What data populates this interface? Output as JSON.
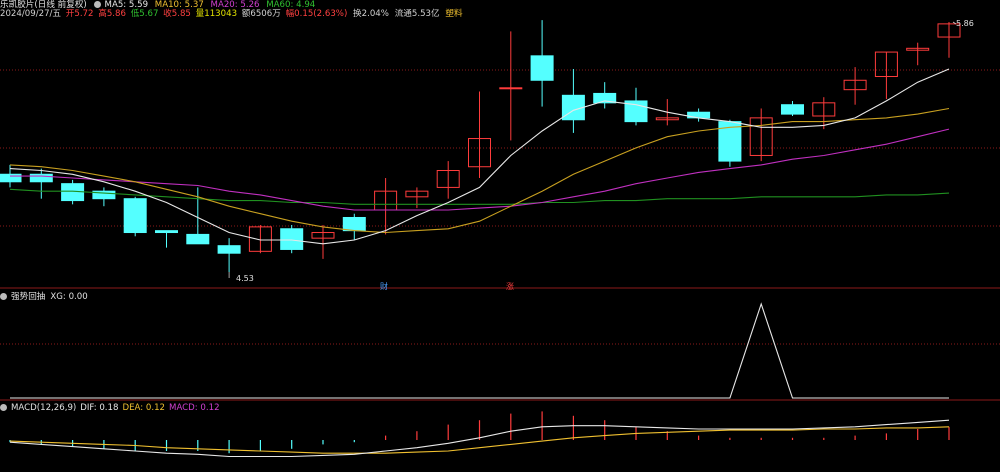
{
  "header": {
    "title": "乐凯胶片(日线 前复权)",
    "ma5": {
      "label": "MA5: 5.59",
      "color": "#e8e8e8"
    },
    "ma10": {
      "label": "MA10: 5.37",
      "color": "#f0c030"
    },
    "ma20": {
      "label": "MA20: 5.26",
      "color": "#d040d0"
    },
    "ma60": {
      "label": "MA60: 4.94",
      "color": "#30c030"
    },
    "date": "2024/09/27/五",
    "open": "开5.72",
    "high": "高5.86",
    "low": "低5.67",
    "close": "收5.85",
    "volume": "量113043",
    "amount": "额6506万",
    "change": "幅0.15(2.63%)",
    "turnover": "换2.04%",
    "float_cap": "流通5.53亿",
    "sector": "塑料"
  },
  "annotations": {
    "high_label": "5.86",
    "low_label": "4.53",
    "tag_cai": "财",
    "tag_zhang": "涨"
  },
  "indicator1": {
    "title": "强势回抽",
    "value": "XG: 0.00"
  },
  "indicator2": {
    "title": "MACD(12,26,9)",
    "dif": "DIF: 0.18",
    "dea": "DEA: 0.12",
    "macd": "MACD: 0.12"
  },
  "colors": {
    "up": "#ff3c3c",
    "down": "#54ffff",
    "grid": "#8b1a1a",
    "ma5": "#e8e8e8",
    "ma10": "#c8a020",
    "ma20": "#c030c0",
    "ma60": "#209020"
  },
  "chart_data": {
    "type": "candlestick",
    "candles": [
      {
        "o": 5.05,
        "h": 5.1,
        "l": 4.98,
        "c": 5.01
      },
      {
        "o": 5.05,
        "h": 5.08,
        "l": 4.92,
        "c": 5.01
      },
      {
        "o": 5.0,
        "h": 5.02,
        "l": 4.89,
        "c": 4.91
      },
      {
        "o": 4.96,
        "h": 4.98,
        "l": 4.88,
        "c": 4.92
      },
      {
        "o": 4.92,
        "h": 4.93,
        "l": 4.72,
        "c": 4.74
      },
      {
        "o": 4.75,
        "h": 4.75,
        "l": 4.66,
        "c": 4.74
      },
      {
        "o": 4.73,
        "h": 4.98,
        "l": 4.69,
        "c": 4.68
      },
      {
        "o": 4.67,
        "h": 4.71,
        "l": 4.53,
        "c": 4.63
      },
      {
        "o": 4.64,
        "h": 4.78,
        "l": 4.63,
        "c": 4.77
      },
      {
        "o": 4.76,
        "h": 4.78,
        "l": 4.63,
        "c": 4.65
      },
      {
        "o": 4.71,
        "h": 4.78,
        "l": 4.6,
        "c": 4.74
      },
      {
        "o": 4.82,
        "h": 4.84,
        "l": 4.7,
        "c": 4.75
      },
      {
        "o": 4.86,
        "h": 5.03,
        "l": 4.73,
        "c": 4.96
      },
      {
        "o": 4.93,
        "h": 4.98,
        "l": 4.87,
        "c": 4.96
      },
      {
        "o": 4.98,
        "h": 5.12,
        "l": 4.92,
        "c": 5.07
      },
      {
        "o": 5.09,
        "h": 5.49,
        "l": 5.03,
        "c": 5.24
      },
      {
        "o": 5.51,
        "h": 5.81,
        "l": 5.23,
        "c": 5.51
      },
      {
        "o": 5.68,
        "h": 5.87,
        "l": 5.41,
        "c": 5.55
      },
      {
        "o": 5.47,
        "h": 5.61,
        "l": 5.27,
        "c": 5.34
      },
      {
        "o": 5.48,
        "h": 5.54,
        "l": 5.4,
        "c": 5.43
      },
      {
        "o": 5.44,
        "h": 5.51,
        "l": 5.31,
        "c": 5.33
      },
      {
        "o": 5.34,
        "h": 5.45,
        "l": 5.31,
        "c": 5.35
      },
      {
        "o": 5.38,
        "h": 5.4,
        "l": 5.33,
        "c": 5.35
      },
      {
        "o": 5.33,
        "h": 5.34,
        "l": 5.09,
        "c": 5.12
      },
      {
        "o": 5.15,
        "h": 5.4,
        "l": 5.12,
        "c": 5.35
      },
      {
        "o": 5.42,
        "h": 5.44,
        "l": 5.36,
        "c": 5.37
      },
      {
        "o": 5.36,
        "h": 5.46,
        "l": 5.29,
        "c": 5.43
      },
      {
        "o": 5.5,
        "h": 5.62,
        "l": 5.42,
        "c": 5.55
      },
      {
        "o": 5.57,
        "h": 5.7,
        "l": 5.45,
        "c": 5.7
      },
      {
        "o": 5.71,
        "h": 5.75,
        "l": 5.63,
        "c": 5.72
      },
      {
        "o": 5.78,
        "h": 5.86,
        "l": 5.67,
        "c": 5.85
      }
    ],
    "ma5": [
      5.08,
      5.07,
      5.05,
      5.01,
      4.96,
      4.9,
      4.82,
      4.74,
      4.7,
      4.7,
      4.68,
      4.7,
      4.75,
      4.83,
      4.9,
      4.98,
      5.15,
      5.28,
      5.39,
      5.44,
      5.42,
      5.38,
      5.35,
      5.33,
      5.3,
      5.3,
      5.31,
      5.35,
      5.44,
      5.54,
      5.61
    ],
    "ma10": [
      5.1,
      5.09,
      5.07,
      5.04,
      5.01,
      4.97,
      4.93,
      4.88,
      4.84,
      4.8,
      4.77,
      4.75,
      4.74,
      4.75,
      4.76,
      4.8,
      4.88,
      4.96,
      5.05,
      5.12,
      5.19,
      5.25,
      5.28,
      5.3,
      5.31,
      5.33,
      5.33,
      5.34,
      5.35,
      5.37,
      5.4
    ],
    "ma20": [
      5.04,
      5.04,
      5.03,
      5.02,
      5.01,
      5.0,
      4.99,
      4.96,
      4.94,
      4.91,
      4.88,
      4.86,
      4.86,
      4.86,
      4.86,
      4.87,
      4.88,
      4.9,
      4.93,
      4.96,
      5.0,
      5.03,
      5.06,
      5.08,
      5.1,
      5.13,
      5.15,
      5.18,
      5.21,
      5.25,
      5.29
    ],
    "ma60": [
      4.97,
      4.96,
      4.96,
      4.95,
      4.94,
      4.93,
      4.92,
      4.91,
      4.91,
      4.9,
      4.9,
      4.89,
      4.89,
      4.89,
      4.89,
      4.89,
      4.89,
      4.9,
      4.9,
      4.91,
      4.91,
      4.92,
      4.92,
      4.92,
      4.93,
      4.93,
      4.93,
      4.93,
      4.94,
      4.94,
      4.95
    ],
    "xg": [
      0,
      0,
      0,
      0,
      0,
      0,
      0,
      0,
      0,
      0,
      0,
      0,
      0,
      0,
      0,
      0,
      0,
      0,
      0,
      0,
      0,
      0,
      0,
      0,
      1,
      0,
      0,
      0,
      0,
      0,
      0
    ],
    "dif": [
      -0.02,
      -0.04,
      -0.06,
      -0.08,
      -0.1,
      -0.12,
      -0.13,
      -0.15,
      -0.15,
      -0.15,
      -0.14,
      -0.13,
      -0.1,
      -0.07,
      -0.03,
      0.02,
      0.08,
      0.12,
      0.13,
      0.13,
      0.12,
      0.11,
      0.1,
      0.1,
      0.1,
      0.1,
      0.11,
      0.12,
      0.14,
      0.16,
      0.18
    ],
    "dea": [
      -0.01,
      -0.02,
      -0.03,
      -0.04,
      -0.05,
      -0.07,
      -0.08,
      -0.09,
      -0.1,
      -0.11,
      -0.12,
      -0.12,
      -0.12,
      -0.11,
      -0.1,
      -0.07,
      -0.04,
      -0.01,
      0.02,
      0.04,
      0.06,
      0.07,
      0.08,
      0.09,
      0.09,
      0.09,
      0.1,
      0.1,
      0.11,
      0.11,
      0.12
    ],
    "macd": [
      -0.02,
      -0.04,
      -0.06,
      -0.08,
      -0.1,
      -0.1,
      -0.1,
      -0.12,
      -0.1,
      -0.08,
      -0.04,
      -0.02,
      0.04,
      0.08,
      0.14,
      0.18,
      0.24,
      0.26,
      0.22,
      0.18,
      0.12,
      0.08,
      0.04,
      0.02,
      0.02,
      0.02,
      0.02,
      0.04,
      0.06,
      0.1,
      0.12
    ]
  }
}
